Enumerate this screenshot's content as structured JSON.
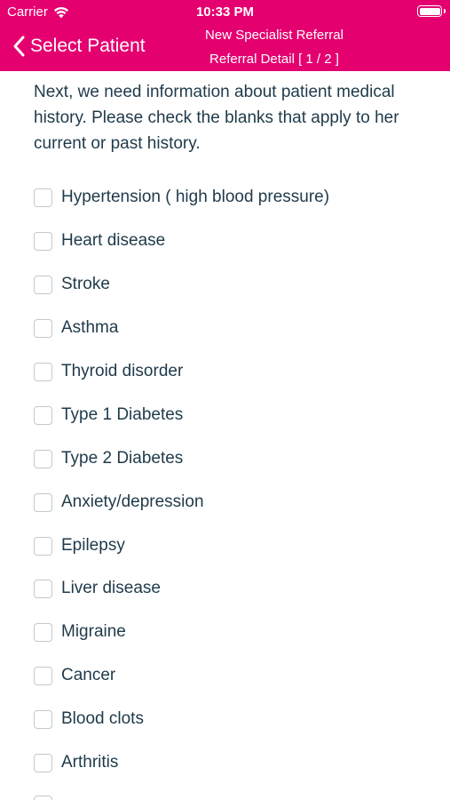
{
  "status_bar": {
    "carrier": "Carrier",
    "time": "10:33 PM",
    "wifi_icon": "wifi-icon",
    "battery_icon": "battery-icon"
  },
  "nav": {
    "back_label": "Select Patient",
    "back_icon": "chevron-left-icon",
    "title_line1": "New Specialist Referral",
    "title_line2": "Referral Detail [ 1 / 2 ]",
    "accent_color": "#e4006f"
  },
  "intro": "Next, we need information about patient medical history. Please check the blanks that apply to her current or past history.",
  "options": [
    {
      "label": "Hypertension ( high blood pressure)",
      "checked": false
    },
    {
      "label": "Heart disease",
      "checked": false
    },
    {
      "label": "Stroke",
      "checked": false
    },
    {
      "label": "Asthma",
      "checked": false
    },
    {
      "label": "Thyroid disorder",
      "checked": false
    },
    {
      "label": "Type 1 Diabetes",
      "checked": false
    },
    {
      "label": "Type 2 Diabetes",
      "checked": false
    },
    {
      "label": "Anxiety/depression",
      "checked": false
    },
    {
      "label": "Epilepsy",
      "checked": false
    },
    {
      "label": "Liver disease",
      "checked": false
    },
    {
      "label": "Migraine",
      "checked": false
    },
    {
      "label": "Cancer",
      "checked": false
    },
    {
      "label": "Blood clots",
      "checked": false
    },
    {
      "label": "Arthritis",
      "checked": false
    }
  ]
}
